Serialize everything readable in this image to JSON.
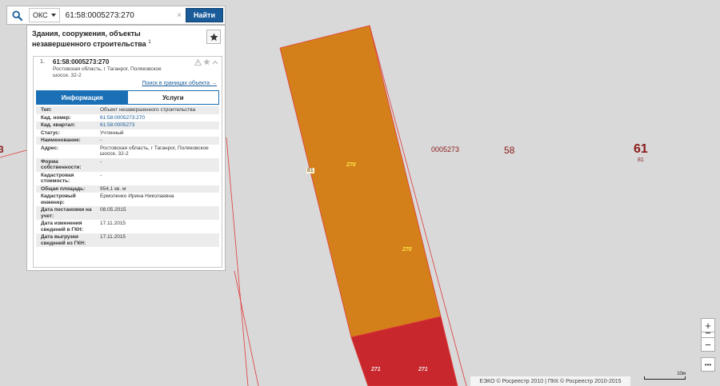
{
  "search": {
    "type_label": "ОКС",
    "query": "61:58:0005273:270",
    "clear_icon": "×",
    "button_label": "Найти"
  },
  "panel": {
    "title": "Здания, сооружения, объекты незавершенного строительства",
    "count": "1",
    "card": {
      "index": "1.",
      "cad_number": "61:58:0005273:270",
      "address": "Ростовская область, г Таганрог, Поляковское шоссе, 32-2",
      "search_link": "Поиск в границах объекта →"
    },
    "tabs": [
      {
        "label": "Информация",
        "active": true
      },
      {
        "label": "Услуги",
        "active": false
      }
    ],
    "attributes": [
      {
        "key": "Тип:",
        "value": "Объект незавершенного строительства",
        "link": false
      },
      {
        "key": "Кад. номер:",
        "value": "61:58:0005273:270",
        "link": true
      },
      {
        "key": "Кад. квартал:",
        "value": "61:58:0005273",
        "link": true
      },
      {
        "key": "Статус:",
        "value": "Учтенный",
        "link": false
      },
      {
        "key": "Наименование:",
        "value": "-",
        "link": false
      },
      {
        "key": "Адрес:",
        "value": "Ростовская область, г Таганрог, Поляковское шоссе, 32-2",
        "link": false
      },
      {
        "key": "Форма собственности:",
        "value": "-",
        "link": false
      },
      {
        "key": "Кадастровая стоимость:",
        "value": "-",
        "link": false
      },
      {
        "key": "Общая площадь:",
        "value": "954,1 кв. м",
        "link": false
      },
      {
        "key": "Кадастровый инженер:",
        "value": "Ермоленко Ирина Николаевна",
        "link": false
      },
      {
        "key": "Дата постановки на учет:",
        "value": "08.05.2015",
        "link": false
      },
      {
        "key": "Дата изменения сведений в ГКН:",
        "value": "17.11.2015",
        "link": false
      },
      {
        "key": "Дата выгрузки сведений из ГКН:",
        "value": "17.11.2015",
        "link": false
      }
    ]
  },
  "map": {
    "labels": {
      "quarter": "0005273",
      "district": "58",
      "region": "61",
      "region_sub": "81",
      "parcel_81": "81",
      "bldg_1": "270",
      "bldg_2": "270",
      "bldg_3": "271",
      "bldg_4": "271",
      "left_edge": "3"
    },
    "colors": {
      "background": "#d9d9d9",
      "building_main": "#d4801a",
      "building_selected": "#c8282d",
      "boundary": "#e03a3a"
    }
  },
  "controls": {
    "zoom_in": "+",
    "zoom_dots": "•••",
    "zoom_out": "−",
    "more": "•••"
  },
  "attribution": "ЕЭКО © Росреестр 2010 | ПКК © Росреестр 2010-2015",
  "scale_label": "10м"
}
